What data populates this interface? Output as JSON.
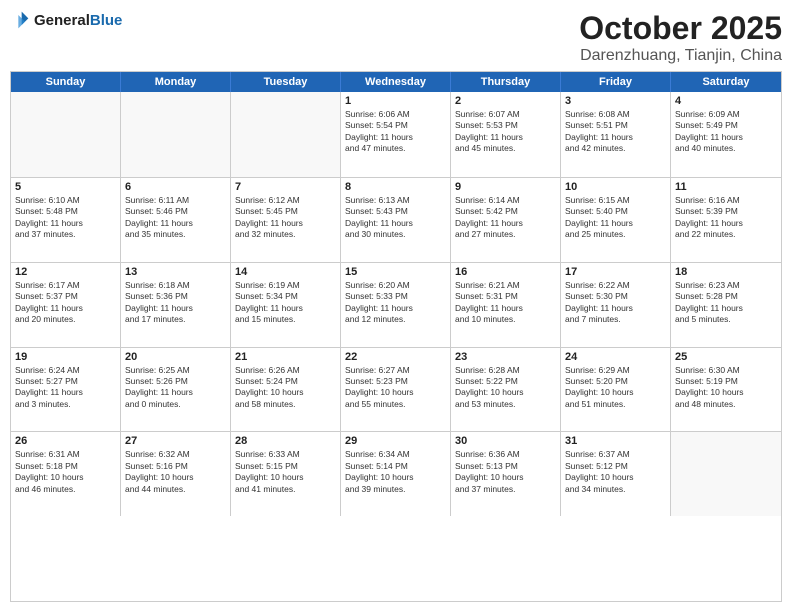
{
  "header": {
    "logo_line1": "General",
    "logo_line2": "Blue",
    "month": "October 2025",
    "location": "Darenzhuang, Tianjin, China"
  },
  "days_of_week": [
    "Sunday",
    "Monday",
    "Tuesday",
    "Wednesday",
    "Thursday",
    "Friday",
    "Saturday"
  ],
  "weeks": [
    [
      {
        "day": "",
        "text": "",
        "empty": true
      },
      {
        "day": "",
        "text": "",
        "empty": true
      },
      {
        "day": "",
        "text": "",
        "empty": true
      },
      {
        "day": "1",
        "text": "Sunrise: 6:06 AM\nSunset: 5:54 PM\nDaylight: 11 hours\nand 47 minutes."
      },
      {
        "day": "2",
        "text": "Sunrise: 6:07 AM\nSunset: 5:53 PM\nDaylight: 11 hours\nand 45 minutes."
      },
      {
        "day": "3",
        "text": "Sunrise: 6:08 AM\nSunset: 5:51 PM\nDaylight: 11 hours\nand 42 minutes."
      },
      {
        "day": "4",
        "text": "Sunrise: 6:09 AM\nSunset: 5:49 PM\nDaylight: 11 hours\nand 40 minutes."
      }
    ],
    [
      {
        "day": "5",
        "text": "Sunrise: 6:10 AM\nSunset: 5:48 PM\nDaylight: 11 hours\nand 37 minutes."
      },
      {
        "day": "6",
        "text": "Sunrise: 6:11 AM\nSunset: 5:46 PM\nDaylight: 11 hours\nand 35 minutes."
      },
      {
        "day": "7",
        "text": "Sunrise: 6:12 AM\nSunset: 5:45 PM\nDaylight: 11 hours\nand 32 minutes."
      },
      {
        "day": "8",
        "text": "Sunrise: 6:13 AM\nSunset: 5:43 PM\nDaylight: 11 hours\nand 30 minutes."
      },
      {
        "day": "9",
        "text": "Sunrise: 6:14 AM\nSunset: 5:42 PM\nDaylight: 11 hours\nand 27 minutes."
      },
      {
        "day": "10",
        "text": "Sunrise: 6:15 AM\nSunset: 5:40 PM\nDaylight: 11 hours\nand 25 minutes."
      },
      {
        "day": "11",
        "text": "Sunrise: 6:16 AM\nSunset: 5:39 PM\nDaylight: 11 hours\nand 22 minutes."
      }
    ],
    [
      {
        "day": "12",
        "text": "Sunrise: 6:17 AM\nSunset: 5:37 PM\nDaylight: 11 hours\nand 20 minutes."
      },
      {
        "day": "13",
        "text": "Sunrise: 6:18 AM\nSunset: 5:36 PM\nDaylight: 11 hours\nand 17 minutes."
      },
      {
        "day": "14",
        "text": "Sunrise: 6:19 AM\nSunset: 5:34 PM\nDaylight: 11 hours\nand 15 minutes."
      },
      {
        "day": "15",
        "text": "Sunrise: 6:20 AM\nSunset: 5:33 PM\nDaylight: 11 hours\nand 12 minutes."
      },
      {
        "day": "16",
        "text": "Sunrise: 6:21 AM\nSunset: 5:31 PM\nDaylight: 11 hours\nand 10 minutes."
      },
      {
        "day": "17",
        "text": "Sunrise: 6:22 AM\nSunset: 5:30 PM\nDaylight: 11 hours\nand 7 minutes."
      },
      {
        "day": "18",
        "text": "Sunrise: 6:23 AM\nSunset: 5:28 PM\nDaylight: 11 hours\nand 5 minutes."
      }
    ],
    [
      {
        "day": "19",
        "text": "Sunrise: 6:24 AM\nSunset: 5:27 PM\nDaylight: 11 hours\nand 3 minutes."
      },
      {
        "day": "20",
        "text": "Sunrise: 6:25 AM\nSunset: 5:26 PM\nDaylight: 11 hours\nand 0 minutes."
      },
      {
        "day": "21",
        "text": "Sunrise: 6:26 AM\nSunset: 5:24 PM\nDaylight: 10 hours\nand 58 minutes."
      },
      {
        "day": "22",
        "text": "Sunrise: 6:27 AM\nSunset: 5:23 PM\nDaylight: 10 hours\nand 55 minutes."
      },
      {
        "day": "23",
        "text": "Sunrise: 6:28 AM\nSunset: 5:22 PM\nDaylight: 10 hours\nand 53 minutes."
      },
      {
        "day": "24",
        "text": "Sunrise: 6:29 AM\nSunset: 5:20 PM\nDaylight: 10 hours\nand 51 minutes."
      },
      {
        "day": "25",
        "text": "Sunrise: 6:30 AM\nSunset: 5:19 PM\nDaylight: 10 hours\nand 48 minutes."
      }
    ],
    [
      {
        "day": "26",
        "text": "Sunrise: 6:31 AM\nSunset: 5:18 PM\nDaylight: 10 hours\nand 46 minutes."
      },
      {
        "day": "27",
        "text": "Sunrise: 6:32 AM\nSunset: 5:16 PM\nDaylight: 10 hours\nand 44 minutes."
      },
      {
        "day": "28",
        "text": "Sunrise: 6:33 AM\nSunset: 5:15 PM\nDaylight: 10 hours\nand 41 minutes."
      },
      {
        "day": "29",
        "text": "Sunrise: 6:34 AM\nSunset: 5:14 PM\nDaylight: 10 hours\nand 39 minutes."
      },
      {
        "day": "30",
        "text": "Sunrise: 6:36 AM\nSunset: 5:13 PM\nDaylight: 10 hours\nand 37 minutes."
      },
      {
        "day": "31",
        "text": "Sunrise: 6:37 AM\nSunset: 5:12 PM\nDaylight: 10 hours\nand 34 minutes."
      },
      {
        "day": "",
        "text": "",
        "empty": true
      }
    ]
  ]
}
